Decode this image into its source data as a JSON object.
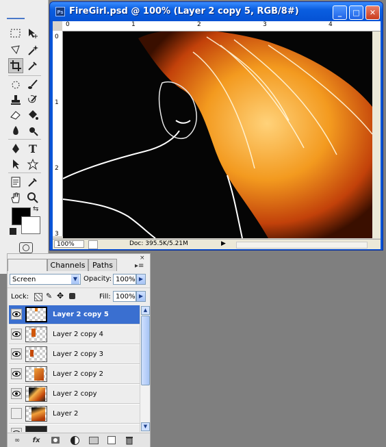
{
  "document": {
    "title": "FireGirl.psd @ 100% (Layer 2 copy 5, RGB/8#)",
    "app_icon_label": "Ps",
    "ruler_numbers": [
      "0",
      "1",
      "2",
      "3",
      "4"
    ],
    "ruler_left_numbers": [
      "0",
      "1",
      "2",
      "3"
    ],
    "zoom_value": "100%",
    "doc_info": "Doc: 395.5K/5.21M"
  },
  "window_controls": {
    "minimize": "_",
    "maximize": "□",
    "close": "✕"
  },
  "tools_panel": {
    "icons": [
      "marquee-icon",
      "move-icon",
      "lasso-icon",
      "magic-wand-icon",
      "crop-icon",
      "eyedropper-icon",
      "healing-brush-icon",
      "brush-icon",
      "clone-stamp-icon",
      "history-brush-icon",
      "eraser-icon",
      "paint-bucket-icon",
      "blur-icon",
      "dodge-icon",
      "pen-icon",
      "type-icon",
      "path-selection-icon",
      "custom-shape-icon",
      "notes-icon",
      "eyedropper-2-icon",
      "hand-icon",
      "zoom-icon"
    ],
    "foreground_color": "#000000",
    "background_color": "#ffffff"
  },
  "layers_panel": {
    "tabs": [
      "Channels",
      "Paths"
    ],
    "blend_mode": "Screen",
    "opacity_label": "Opacity:",
    "opacity_value": "100%",
    "lock_label": "Lock:",
    "fill_label": "Fill:",
    "fill_value": "100%",
    "layers": [
      {
        "name": "Layer 2 copy 5",
        "visible": true,
        "selected": true
      },
      {
        "name": "Layer 2 copy 4",
        "visible": true,
        "selected": false
      },
      {
        "name": "Layer 2 copy 3",
        "visible": true,
        "selected": false
      },
      {
        "name": "Layer 2 copy 2",
        "visible": true,
        "selected": false
      },
      {
        "name": "Layer 2 copy",
        "visible": true,
        "selected": false
      },
      {
        "name": "Layer 2",
        "visible": false,
        "selected": false
      }
    ],
    "bottom_icons": [
      "link-layers-icon",
      "fx-icon",
      "add-mask-icon",
      "adjustment-layer-icon",
      "new-group-icon",
      "new-layer-icon",
      "delete-layer-icon"
    ],
    "fx_label": "fx"
  },
  "colors": {
    "accent": "#3a6fd0",
    "titlebar": "#0a5ee0"
  }
}
